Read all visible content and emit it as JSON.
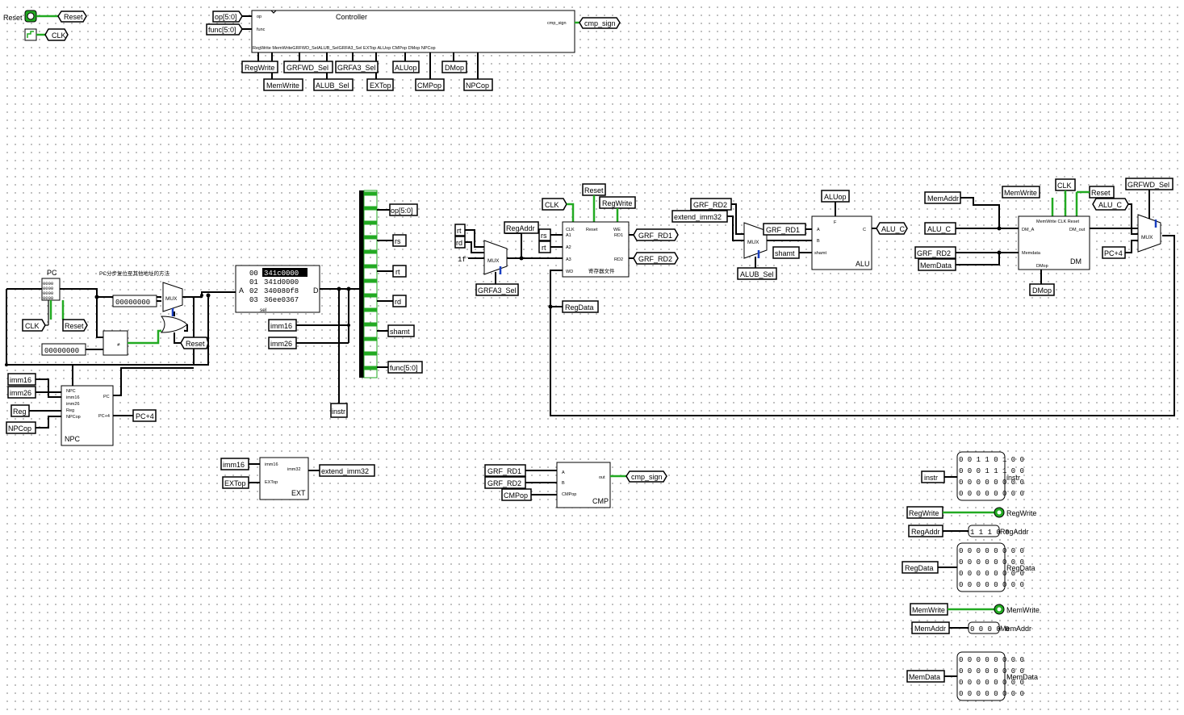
{
  "pins": {
    "reset": "Reset",
    "clk": "CLK",
    "regwrite": "RegWrite",
    "memwrite": "MemWrite",
    "regaddr": "RegAddr",
    "regdata": "RegData",
    "memaddr": "MemAddr",
    "memdata": "MemData",
    "instr": "instr",
    "pc4": "PC+4",
    "imm16": "imm16",
    "imm26": "imm26",
    "reg": "Reg",
    "npcop": "NPCop",
    "extop": "EXTop",
    "extend_imm32": "extend_imm32",
    "grf_rd1": "GRF_RD1",
    "grf_rd2": "GRF_RD2",
    "cmpop": "CMPop",
    "cmp_sign": "cmp_sign",
    "rt": "rt",
    "rd": "rd",
    "rs": "rs",
    "shamt": "shamt",
    "op": "op[5:0]",
    "func": "func[5:0]",
    "grfa3_sel": "GRFA3_Sel",
    "alub_sel": "ALUB_Sel",
    "aluop": "ALUop",
    "alu_c": "ALU_C",
    "grfwd_sel": "GRFWD_Sel",
    "dmop": "DMop",
    "grfwd_sel_out": "GRFWD_Sel",
    "grfa3_sel_out": "GRFA3_Sel",
    "alub_sel_out": "ALUB_Sel"
  },
  "controller": {
    "title": "Controller",
    "inputs": [
      "op",
      "func"
    ],
    "output": "cmp_sign",
    "signals": [
      "RegWrite",
      "MemWrite",
      "GRFWD_Sel",
      "ALUB_Sel",
      "GRFA3_Sel",
      "EXTop",
      "ALUop",
      "CMPop",
      "DMop",
      "NPCop"
    ],
    "bottom_label": "RegWrite  MemWriteGRFWD_SelALUB_SelGRFA3_Sel  EXTop    ALUop     CMPop     DMop      NPCop"
  },
  "pc": {
    "label": "PC",
    "bits": [
      "0000",
      "0000",
      "0000",
      "0000"
    ],
    "note": "PC分步复位至其他地址的方法"
  },
  "rom": {
    "addresses": [
      "00",
      "01",
      "02",
      "03"
    ],
    "values": [
      "341c0000",
      "341d0000",
      "340080f8",
      "36ee0367"
    ],
    "port_a": "A",
    "port_d": "D",
    "sel": "sel"
  },
  "constants": {
    "const1": "00000000",
    "const2": "00000000",
    "grf_a3_const": "1f"
  },
  "mux": {
    "label": "MUX"
  },
  "npc": {
    "name": "NPC",
    "ports": [
      "NPC",
      "imm16",
      "imm26",
      "Reg",
      "NPCop"
    ],
    "outs": [
      "PC",
      "PC+4"
    ]
  },
  "ext": {
    "name": "EXT",
    "ports": [
      "imm16",
      "EXTop"
    ],
    "out": "imm32"
  },
  "cmp": {
    "name": "CMP",
    "ports": [
      "A",
      "B",
      "CMPop"
    ],
    "out": "out"
  },
  "grf": {
    "name": "寄存器文件",
    "ports": [
      "CLK",
      "A1",
      "A2",
      "A3",
      "WD"
    ],
    "top": [
      "Reset",
      "WE"
    ],
    "outs": [
      "RD1",
      "RD2"
    ]
  },
  "alu": {
    "name": "ALU",
    "ports": [
      "A",
      "B",
      "shamt"
    ],
    "top": "F",
    "out": "C"
  },
  "dm": {
    "name": "DM",
    "ports": [
      "DM_A",
      "Memdata",
      "DMop"
    ],
    "top": "MemWrite CLK   Reset",
    "out": "DM_out"
  },
  "probes": {
    "instr_rows": [
      "0 0 1 1 0 1 0 0",
      "0 0 0 1 1 1 0 0",
      "0 0 0 0 0 0 0 0",
      "0 0 0 0 0 0 0 0"
    ],
    "regaddr_val": "1 1 1 0 0",
    "regdata_rows": [
      "0 0 0 0 0 0 0 0",
      "0 0 0 0 0 0 0 0",
      "0 0 0 0 0 0 0 0",
      "0 0 0 0 0 0 0 0"
    ],
    "memaddr_val": "0 0 0 0 0",
    "memdata_rows": [
      "0 0 0 0 0 0 0 0",
      "0 0 0 0 0 0 0 0",
      "0 0 0 0 0 0 0 0",
      "0 0 0 0 0 0 0 0"
    ]
  },
  "colors": {
    "wire": "#000000",
    "active": "#22aa22",
    "tunnel_text": "#000000",
    "mux_bit": "#1a3fc0"
  }
}
